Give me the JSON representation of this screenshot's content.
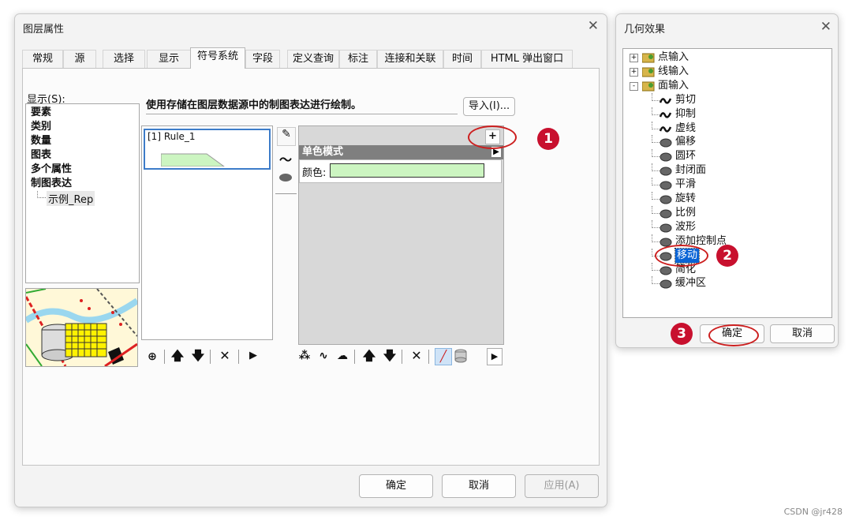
{
  "layer_dialog": {
    "title": "图层属性",
    "tabs": [
      "常规",
      "源",
      "选择",
      "显示",
      "符号系统",
      "字段",
      "定义查询",
      "标注",
      "连接和关联",
      "时间",
      "HTML 弹出窗口"
    ],
    "active_tab": "符号系统",
    "show_label": "显示(S):",
    "show_items": [
      "要素",
      "类别",
      "数量",
      "图表",
      "多个属性",
      "制图表达"
    ],
    "show_subitem": "示例_Rep",
    "description": "使用存储在图层数据源中的制图表达进行绘制。",
    "import_button": "导入(I)...",
    "rule_label": "[1] Rule_1",
    "plus_button": "+",
    "mode_header": "单色模式",
    "color_label": "颜色:",
    "color_value": "#ccf5c1",
    "ok_button": "确定",
    "cancel_button": "取消",
    "apply_button": "应用(A)"
  },
  "geo_dialog": {
    "title": "几何效果",
    "tree": [
      {
        "label": "点输入",
        "type": "folder",
        "expander": "+"
      },
      {
        "label": "线输入",
        "type": "folder",
        "expander": "+"
      },
      {
        "label": "面输入",
        "type": "folder",
        "expander": "-"
      },
      {
        "label": "剪切",
        "type": "line"
      },
      {
        "label": "抑制",
        "type": "line"
      },
      {
        "label": "虚线",
        "type": "line"
      },
      {
        "label": "偏移",
        "type": "poly"
      },
      {
        "label": "圆环",
        "type": "poly"
      },
      {
        "label": "封闭面",
        "type": "poly"
      },
      {
        "label": "平滑",
        "type": "poly"
      },
      {
        "label": "旋转",
        "type": "poly"
      },
      {
        "label": "比例",
        "type": "poly"
      },
      {
        "label": "波形",
        "type": "poly"
      },
      {
        "label": "添加控制点",
        "type": "poly"
      },
      {
        "label": "移动",
        "type": "poly",
        "selected": true
      },
      {
        "label": "简化",
        "type": "poly"
      },
      {
        "label": "缓冲区",
        "type": "poly"
      }
    ],
    "ok_button": "确定",
    "cancel_button": "取消"
  },
  "callouts": [
    "1",
    "2",
    "3"
  ],
  "watermark": "CSDN @jr428",
  "colors": {
    "selection": "#0a64d6",
    "callout": "#c8102e",
    "ellipse": "#cc1f1f",
    "header_bar": "#7f7f7f"
  }
}
